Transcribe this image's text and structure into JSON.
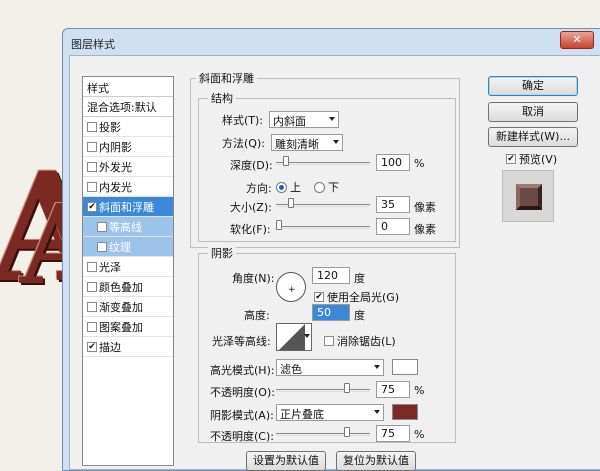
{
  "dialog": {
    "title": "图层样式",
    "close_label": "✕"
  },
  "styles": {
    "header": "样式",
    "blend_default": "混合选项:默认",
    "items": [
      {
        "label": "投影",
        "checked": false
      },
      {
        "label": "内阴影",
        "checked": false
      },
      {
        "label": "外发光",
        "checked": false
      },
      {
        "label": "内发光",
        "checked": false
      },
      {
        "label": "斜面和浮雕",
        "checked": true,
        "selected": true
      },
      {
        "label": "等高线",
        "checked": false,
        "sub": true
      },
      {
        "label": "纹理",
        "checked": false,
        "sub": true
      },
      {
        "label": "光泽",
        "checked": false
      },
      {
        "label": "颜色叠加",
        "checked": false
      },
      {
        "label": "渐变叠加",
        "checked": false
      },
      {
        "label": "图案叠加",
        "checked": false
      },
      {
        "label": "描边",
        "checked": true
      }
    ]
  },
  "bevel": {
    "section_title": "斜面和浮雕",
    "structure_title": "结构",
    "style_label": "样式(T):",
    "style_value": "内斜面",
    "technique_label": "方法(Q):",
    "technique_value": "雕刻清晰",
    "depth_label": "深度(D):",
    "depth_value": "100",
    "depth_unit": "%",
    "depth_fraction": 0.0,
    "direction_label": "方向:",
    "dir_up": "上",
    "dir_down": "下",
    "direction_selected": "上",
    "size_label": "大小(Z):",
    "size_value": "35",
    "size_unit": "像素",
    "size_fraction": 0.14,
    "soften_label": "软化(F):",
    "soften_value": "0",
    "soften_unit": "像素",
    "soften_fraction": 0.0
  },
  "shading": {
    "title": "阴影",
    "angle_label": "角度(N):",
    "angle_value": "120",
    "angle_unit": "度",
    "global_light_label": "使用全局光(G)",
    "global_light": true,
    "altitude_label": "高度:",
    "altitude_value": "50",
    "altitude_unit": "度",
    "gloss_label": "光泽等高线:",
    "antialias_label": "消除锯齿(L)",
    "highlight_mode_label": "高光模式(H):",
    "highlight_mode": "滤色",
    "highlight_color": "#ffffff",
    "highlight_opacity_label": "不透明度(O):",
    "highlight_opacity": "75",
    "opacity_unit": "%",
    "shadow_mode_label": "阴影模式(A):",
    "shadow_mode": "正片叠底",
    "shadow_color": "#7a2a27",
    "shadow_opacity_label": "不透明度(C):",
    "shadow_opacity": "75"
  },
  "buttons": {
    "ok": "确定",
    "cancel": "取消",
    "new_style": "新建样式(W)...",
    "preview_label": "预览(V)",
    "preview_checked": true,
    "make_default": "设置为默认值",
    "reset_default": "复位为默认值"
  }
}
